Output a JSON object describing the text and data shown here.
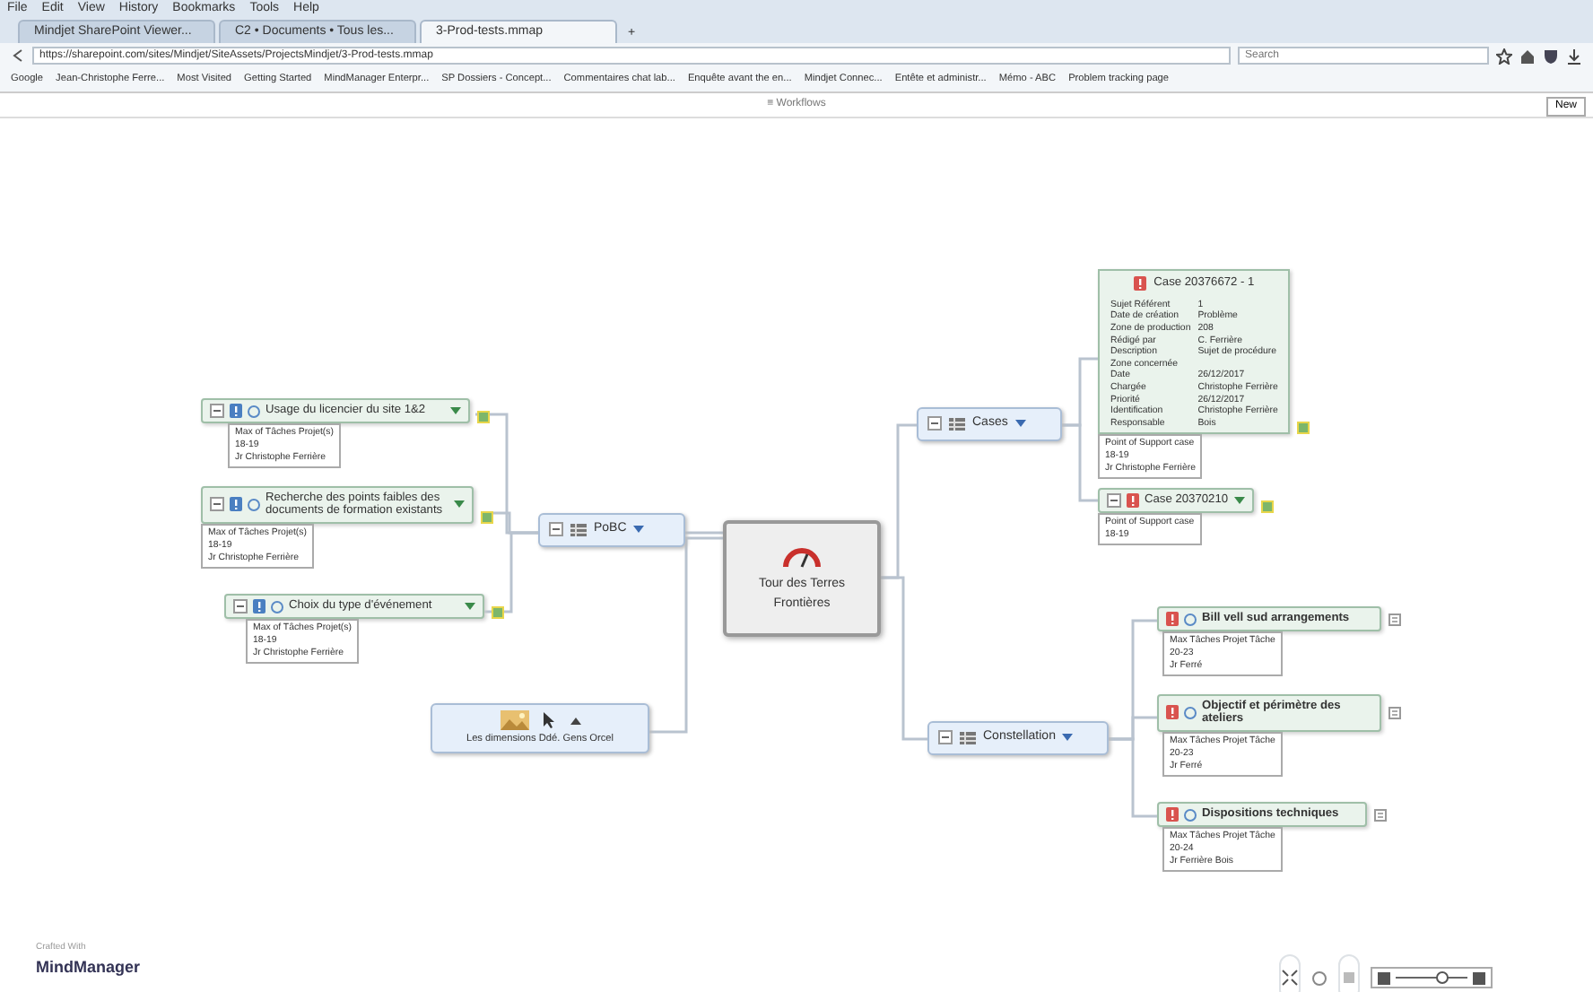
{
  "browser": {
    "menu": [
      "File",
      "Edit",
      "View",
      "History",
      "Bookmarks",
      "Tools",
      "Help"
    ],
    "tabs": [
      {
        "label": "Mindjet SharePoint Viewer...",
        "selected": false
      },
      {
        "label": "C2 • Documents • Tous les...",
        "selected": false
      },
      {
        "label": "3-Prod-tests.mmap",
        "selected": true
      }
    ],
    "new_tab": "+",
    "url": "https://sharepoint.com/sites/Mindjet/SiteAssets/ProjectsMindjet/3-Prod-tests.mmap",
    "search_placeholder": "Search",
    "bookmarks": [
      "Google",
      "Jean-Christophe Ferre...",
      "Most Visited",
      "Getting Started",
      "MindManager Enterpr...",
      "SP Dossiers - Concept...",
      "Commentaires chat lab...",
      "Enquête avant the en...",
      "Mindjet Connec...",
      "Entête et administr...",
      "Mémo - ABC",
      "Problem tracking page"
    ]
  },
  "toolbar": {
    "title": "≡ Workflows",
    "button": "New"
  },
  "map": {
    "central": "Tour des Terres Frontières",
    "left_branch": {
      "label": "PoBC",
      "tasks": [
        {
          "title": "Usage du licencier du site 1&2",
          "notes": [
            "Max of Tâches Projet(s)",
            "18-19",
            "Jr Christophe Ferrière"
          ]
        },
        {
          "title": "Recherche des points faibles des documents de formation existants",
          "notes": [
            "Max of Tâches Projet(s)",
            "18-19",
            "Jr Christophe Ferrière"
          ]
        },
        {
          "title": "Choix du type d'événement",
          "notes": [
            "Max of Tâches Projet(s)",
            "18-19",
            "Jr Christophe Ferrière"
          ]
        }
      ]
    },
    "image_topic": {
      "caption": "Les dimensions  Ddé. Gens Orcel"
    },
    "cases": {
      "label": "Cases",
      "items": [
        {
          "title": "Case 20376672 - 1",
          "table": [
            [
              "Sujet Référent",
              "1"
            ],
            [
              "Date de création",
              "Problème"
            ],
            [
              "Zone de production",
              "208"
            ],
            [
              "Rédigé par",
              "C. Ferrière"
            ],
            [
              "Description",
              "Sujet de procédure"
            ],
            [
              "Zone concernée"
            ],
            [
              "Date",
              "26/12/2017"
            ],
            [
              "Chargée",
              "Christophe Ferrière"
            ],
            [
              "Priorité",
              "26/12/2017"
            ],
            [
              "Identification",
              "Christophe Ferrière"
            ],
            [
              "Responsable",
              "Bois"
            ]
          ],
          "notes": [
            "Point of Support case",
            "18-19",
            "Jr Christophe Ferrière"
          ]
        },
        {
          "title": "Case 20370210",
          "notes": [
            "Point of Support case",
            "18-19"
          ]
        }
      ]
    },
    "constellation": {
      "label": "Constellation",
      "tasks": [
        {
          "title": "Bill vell sud arrangements",
          "notes": [
            "Max Tâches Projet Tâche",
            "20-23",
            "Jr Ferré"
          ]
        },
        {
          "title": "Objectif et périmètre des ateliers",
          "notes": [
            "Max Tâches Projet Tâche",
            "20-23",
            "Jr Ferré"
          ]
        },
        {
          "title": "Dispositions techniques",
          "notes": [
            "Max Tâches Projet Tâche",
            "20-24",
            "Jr Ferrière Bois"
          ]
        }
      ]
    }
  },
  "footer": {
    "brand_small": "Crafted With",
    "brand": "MindManager"
  }
}
